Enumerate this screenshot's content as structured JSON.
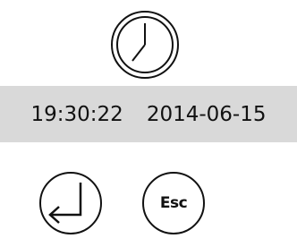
{
  "status": {
    "time": "19:30:22",
    "date": "2014-06-15"
  },
  "icons": {
    "clock": "clock-icon",
    "enter": "enter-return-icon"
  },
  "buttons": {
    "esc_label": "Esc"
  },
  "colors": {
    "bar_background": "#d9d9d9",
    "icon_stroke": "#111111"
  }
}
